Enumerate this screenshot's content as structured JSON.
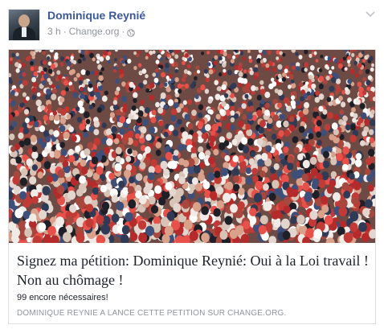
{
  "post": {
    "author": "Dominique Reynié",
    "time": "3 h",
    "separator_1": "·",
    "source": "Change.org",
    "separator_2": "·",
    "privacy_icon": "globe-icon",
    "options_icon": "chevron-down-icon"
  },
  "link_card": {
    "title": "Signez ma pétition: Dominique Reynié: Oui à la Loi travail ! Non au chômage !",
    "description": "99 encore nécessaires!",
    "caption": "DOMINIQUE REYNIE A LANCE CETTE PETITION SUR CHANGE.ORG."
  },
  "colors": {
    "author_link": "#3b5998",
    "meta_text": "#90949c",
    "card_border": "#dddfe2"
  }
}
